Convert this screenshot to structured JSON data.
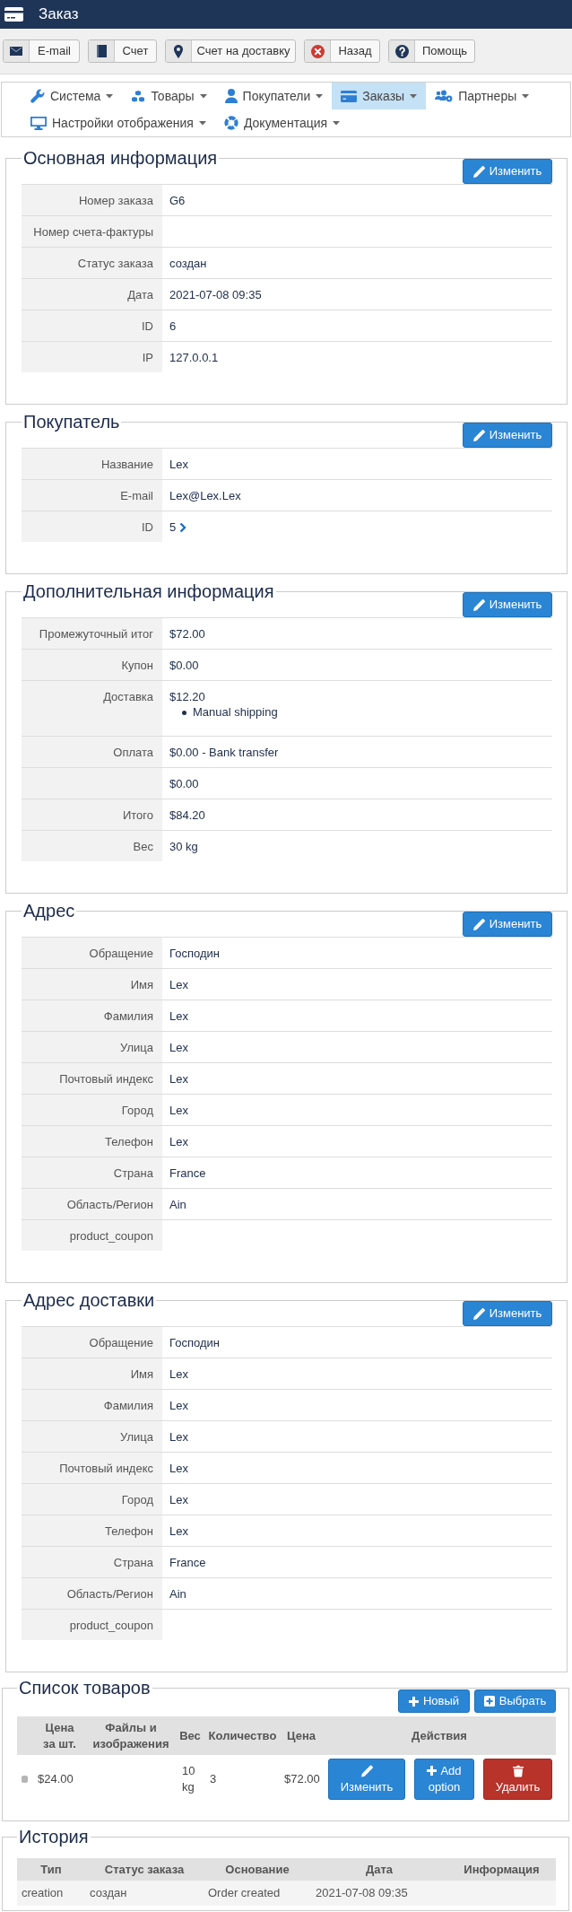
{
  "window": {
    "title": "Заказ"
  },
  "toolbar": [
    {
      "label": "E-mail"
    },
    {
      "label": "Счет"
    },
    {
      "label": "Счет на доставку"
    },
    {
      "label": "Назад"
    },
    {
      "label": "Помощь"
    }
  ],
  "menu": [
    {
      "label": "Система",
      "selected": false
    },
    {
      "label": "Товары",
      "selected": false
    },
    {
      "label": "Покупатели",
      "selected": false
    },
    {
      "label": "Заказы",
      "selected": true
    },
    {
      "label": "Партнеры",
      "selected": false
    },
    {
      "label": "Настройки отображения",
      "selected": false
    },
    {
      "label": "Документация",
      "selected": false
    }
  ],
  "sections": [
    {
      "kind": "details",
      "title": "Основная информация",
      "button": "Изменить",
      "rows": [
        {
          "kind": "text",
          "label": "Номер заказа",
          "value": "G6"
        },
        {
          "kind": "text",
          "label": "Номер счета-фактуры"
        },
        {
          "kind": "text",
          "label": "Статус заказа",
          "value": "создан"
        },
        {
          "kind": "text",
          "label": "Дата",
          "value": "2021-07-08 09:35"
        },
        {
          "kind": "text",
          "label": "ID",
          "value": "6"
        },
        {
          "kind": "text",
          "label": "IP",
          "value": "127.0.0.1"
        }
      ]
    },
    {
      "kind": "details",
      "title": "Покупатель",
      "button": "Изменить",
      "rows": [
        {
          "kind": "text",
          "label": "Название",
          "value": "Lex"
        },
        {
          "kind": "text",
          "label": "E-mail",
          "value": "Lex@Lex.Lex"
        },
        {
          "kind": "link",
          "label": "ID",
          "value": "5"
        }
      ]
    },
    {
      "kind": "details",
      "title": "Дополнительная информация",
      "button": "Изменить",
      "rows": [
        {
          "kind": "text",
          "label": "Промежуточный итог",
          "value": "$72.00"
        },
        {
          "kind": "text",
          "label": "Купон",
          "value": "$0.00"
        },
        {
          "kind": "list",
          "label": "Доставка",
          "value": "$12.20",
          "items": [
            "Manual shipping"
          ]
        },
        {
          "kind": "text",
          "label": "Оплата",
          "value": "$0.00 - Bank transfer"
        },
        {
          "kind": "text",
          "value": "$0.00"
        },
        {
          "kind": "text",
          "label": "Итого",
          "value": "$84.20"
        },
        {
          "kind": "text",
          "label": "Вес",
          "value": "30 kg"
        }
      ]
    },
    {
      "kind": "details",
      "title": "Адрес",
      "button": "Изменить",
      "rows": [
        {
          "kind": "text",
          "label": "Обращение",
          "value": "Господин"
        },
        {
          "kind": "text",
          "label": "Имя",
          "value": "Lex"
        },
        {
          "kind": "text",
          "label": "Фамилия",
          "value": "Lex"
        },
        {
          "kind": "text",
          "label": "Улица",
          "value": "Lex"
        },
        {
          "kind": "text",
          "label": "Почтовый индекс",
          "value": "Lex"
        },
        {
          "kind": "text",
          "label": "Город",
          "value": "Lex"
        },
        {
          "kind": "text",
          "label": "Телефон",
          "value": "Lex"
        },
        {
          "kind": "text",
          "label": "Страна",
          "value": "France"
        },
        {
          "kind": "text",
          "label": "Область/Регион",
          "value": "Ain"
        },
        {
          "kind": "text",
          "label": "product_coupon"
        }
      ]
    },
    {
      "kind": "details",
      "title": "Адрес доставки",
      "button": "Изменить",
      "rows": [
        {
          "kind": "text",
          "label": "Обращение",
          "value": "Господин"
        },
        {
          "kind": "text",
          "label": "Имя",
          "value": "Lex"
        },
        {
          "kind": "text",
          "label": "Фамилия",
          "value": "Lex"
        },
        {
          "kind": "text",
          "label": "Улица",
          "value": "Lex"
        },
        {
          "kind": "text",
          "label": "Почтовый индекс",
          "value": "Lex"
        },
        {
          "kind": "text",
          "label": "Город",
          "value": "Lex"
        },
        {
          "kind": "text",
          "label": "Телефон",
          "value": "Lex"
        },
        {
          "kind": "text",
          "label": "Страна",
          "value": "France"
        },
        {
          "kind": "text",
          "label": "Область/Регион",
          "value": "Ain"
        },
        {
          "kind": "text",
          "label": "product_coupon"
        }
      ]
    },
    {
      "kind": "products",
      "title": "Список товаров",
      "buttons": [
        {
          "kind": "new",
          "label": "Новый"
        },
        {
          "kind": "select",
          "label": "Выбрать"
        }
      ],
      "columns": [
        "Цена за шт.",
        "Файлы и изображения",
        "Вес",
        "Количество",
        "Цена",
        "Действия"
      ],
      "rows": [
        {
          "unit_price": "$24.00",
          "weight": "10 kg",
          "quantity": "3",
          "price": "$72.00",
          "actions": [
            {
              "kind": "edit",
              "label": "Изменить"
            },
            {
              "kind": "add",
              "label": "Add option"
            },
            {
              "kind": "delete",
              "label": "Удалить"
            }
          ]
        }
      ]
    },
    {
      "kind": "history",
      "title": "История",
      "columns": [
        "Тип",
        "Статус заказа",
        "Основание",
        "Дата",
        "Информация"
      ],
      "rows": [
        {
          "type": "creation",
          "status": "создан",
          "reason": "Order created",
          "date": "2021-07-08 09:35"
        }
      ]
    }
  ]
}
